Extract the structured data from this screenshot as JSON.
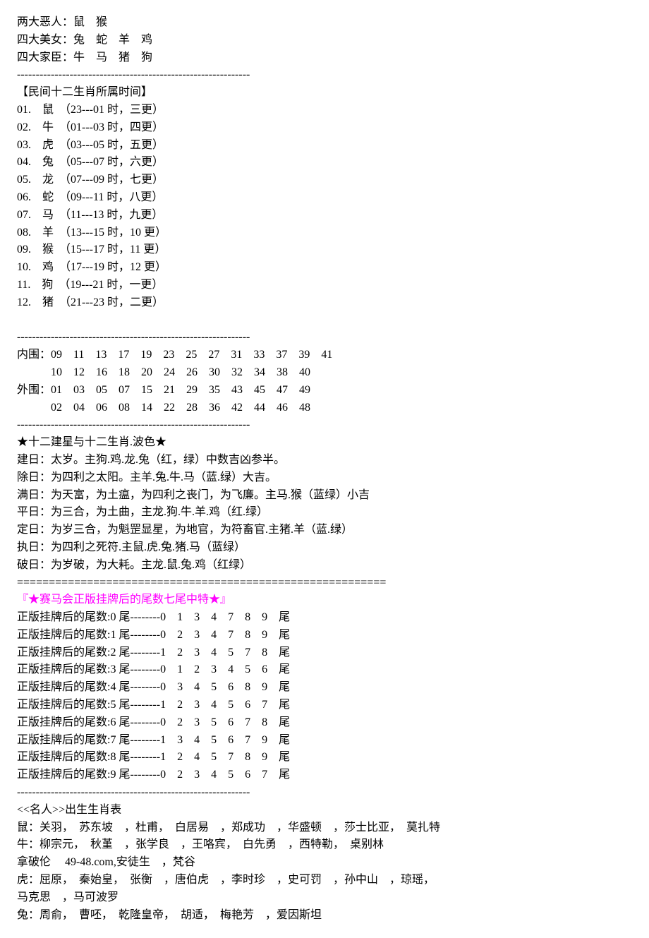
{
  "intro": {
    "line1": "两大恶人：鼠　猴",
    "line2": "四大美女：兔　蛇　羊　鸡",
    "line3": "四大家臣：牛　马　猪　狗"
  },
  "sep_dash": "--------------------------------------------------------------",
  "sep_equal": "==========================================================",
  "zodiac_time": {
    "title": "【民间十二生肖所属时间】",
    "lines": [
      "01.　鼠　（23---01 时，三更）",
      "02.　牛　（01---03 时，四更）",
      "03.　虎　（03---05 时，五更）",
      "04.　兔　（05---07 时，六更）",
      "05.　龙　（07---09 时，七更）",
      "06.　蛇　（09---11 时，八更）",
      "07.　马　（11---13 时，九更）",
      "08.　羊　（13---15 时，10 更）",
      "09.　猴　（15---17 时，11 更）",
      "10.　鸡　（17---19 时，12 更）",
      "11.　狗　（19---21 时，一更）",
      "12.　猪　（21---23 时，二更）"
    ]
  },
  "blank": "　",
  "rings": {
    "line1": "内围：09　11　13　17　19　23　25　27　31　33　37　39　41",
    "line2": "　　　10　12　16　18　20　24　26　30　32　34　38　40",
    "line3": "外围：01　03　05　07　15　21　29　35　43　45　47　49",
    "line4": "　　　02　04　06　08　14　22　28　36　42　44　46　48"
  },
  "jianxing": {
    "title": "★十二建星与十二生肖.波色★",
    "lines": [
      "建日：太岁。主狗.鸡.龙.兔（红，绿）中数吉凶参半。",
      "除日：为四利之太阳。主羊.兔.牛.马（蓝.绿）大吉。",
      "满日：为天富，为土瘟，为四利之丧门，为飞廉。主马.猴（蓝绿）小吉",
      "平日：为三合，为土曲，主龙.狗.牛.羊.鸡（红.绿）",
      "定日：为岁三合，为魁罡显星，为地官，为符畜官.主猪.羊（蓝.绿）",
      "执日：为四利之死符.主鼠.虎.兔.猪.马（蓝绿）",
      "破日：为岁破，为大耗。主龙.鼠.兔.鸡（红绿）"
    ]
  },
  "tail": {
    "title": "『★赛马会正版挂牌后的尾数七尾中特★』",
    "lines": [
      "正版挂牌后的尾数:0 尾--------0　1　3　4　7　8　9　尾",
      "正版挂牌后的尾数:1 尾--------0　2　3　4　7　8　9　尾",
      "正版挂牌后的尾数:2 尾--------1　2　3　4　5　7　8　尾",
      "正版挂牌后的尾数:3 尾--------0　1　2　3　4　5　6　尾",
      "正版挂牌后的尾数:4 尾--------0　3　4　5　6　8　9　尾",
      "正版挂牌后的尾数:5 尾--------1　2　3　4　5　6　7　尾",
      "正版挂牌后的尾数:6 尾--------0　2　3　5　6　7　8　尾",
      "正版挂牌后的尾数:7 尾--------1　3　4　5　6　7　9　尾",
      "正版挂牌后的尾数:8 尾--------1　2　4　5　7　8　9　尾",
      "正版挂牌后的尾数:9 尾--------0　2　3　4　5　6　7　尾"
    ]
  },
  "famous": {
    "title": "<<名人>>出生生肖表",
    "lines": [
      "鼠：关羽，　苏东坡　，杜甫，　白居易　，郑成功　，华盛顿　，莎士比亚，　莫扎特",
      "牛：柳宗元，　秋堇　，张学良　，王咯宾，　白先勇　，西特勒，　桌别林",
      "拿破伦　 49-48.com,安徒生　，梵谷",
      "虎：屈原，　秦始皇，　张衡　，唐伯虎　，李时珍　，史可罚　，孙中山　，琼瑶，",
      "马克思　，马可波罗",
      "兔：周俞，　曹呸，　乾隆皇帝，　胡适，　梅艳芳　，爱因斯坦"
    ]
  }
}
